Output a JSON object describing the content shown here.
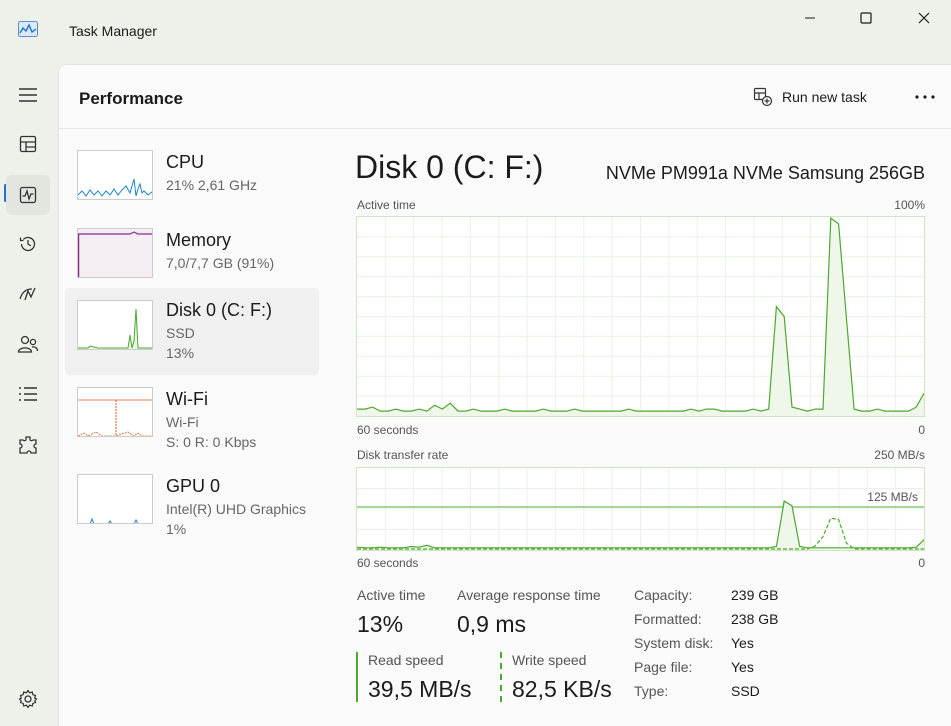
{
  "window": {
    "title": "Task Manager"
  },
  "nav": {
    "items": [
      {
        "name": "hamburger-menu",
        "icon": "hamburger-icon"
      },
      {
        "name": "processes",
        "icon": "processes-icon"
      },
      {
        "name": "performance",
        "icon": "performance-icon",
        "active": true
      },
      {
        "name": "app-history",
        "icon": "history-icon"
      },
      {
        "name": "startup-apps",
        "icon": "startup-icon"
      },
      {
        "name": "users",
        "icon": "users-icon"
      },
      {
        "name": "details",
        "icon": "details-icon"
      },
      {
        "name": "services",
        "icon": "services-icon"
      },
      {
        "name": "settings",
        "icon": "gear-icon"
      }
    ]
  },
  "header": {
    "title": "Performance",
    "run_new_task": "Run new task"
  },
  "devices": [
    {
      "name": "CPU",
      "line1": "21% 2,61 GHz",
      "line2": ""
    },
    {
      "name": "Memory",
      "line1": "7,0/7,7 GB (91%)",
      "line2": ""
    },
    {
      "name": "Disk 0 (C: F:)",
      "line1": "SSD",
      "line2": "13%",
      "selected": true
    },
    {
      "name": "Wi-Fi",
      "line1": "Wi-Fi",
      "line2": "S: 0 R: 0 Kbps"
    },
    {
      "name": "GPU 0",
      "line1": "Intel(R) UHD Graphics",
      "line2": "1%"
    }
  ],
  "detail": {
    "title": "Disk 0 (C: F:)",
    "model": "NVMe PM991a NVMe Samsung 256GB",
    "active_time_graph": {
      "label": "Active time",
      "max_label": "100%",
      "time_label": "60 seconds",
      "min_label": "0",
      "values": [
        3,
        3,
        4,
        2,
        2,
        3,
        2,
        2,
        3,
        2,
        5,
        3,
        6,
        2,
        2,
        3,
        2,
        2,
        2,
        3,
        2,
        2,
        2,
        2,
        3,
        2,
        2,
        2,
        3,
        2,
        2,
        2,
        2,
        2,
        2,
        3,
        2,
        2,
        2,
        2,
        2,
        2,
        2,
        3,
        2,
        3,
        3,
        2,
        2,
        2,
        2,
        3,
        2,
        3,
        55,
        50,
        4,
        3,
        2,
        3,
        3,
        100,
        97,
        50,
        3,
        2,
        2,
        3,
        2,
        2,
        2,
        2,
        4,
        11
      ]
    },
    "transfer_graph": {
      "label": "Disk transfer rate",
      "max_label": "250 MB/s",
      "mid_label": "125 MB/s",
      "time_label": "60 seconds",
      "min_label": "0",
      "read_values": [
        3,
        2,
        2,
        3,
        2,
        2,
        2,
        4,
        3,
        6,
        2,
        2,
        2,
        2,
        2,
        2,
        2,
        2,
        2,
        2,
        2,
        2,
        2,
        2,
        2,
        2,
        2,
        2,
        2,
        2,
        2,
        2,
        2,
        2,
        2,
        2,
        2,
        2,
        2,
        2,
        2,
        2,
        2,
        2,
        2,
        2,
        2,
        2,
        2,
        2,
        2,
        2,
        2,
        2,
        4,
        78,
        70,
        4,
        2,
        2,
        2,
        2,
        2,
        2,
        2,
        2,
        2,
        2,
        2,
        2,
        2,
        2,
        3,
        15
      ],
      "write_values": [
        0,
        0,
        0,
        0,
        0,
        0,
        0,
        0,
        0,
        0,
        0,
        0,
        0,
        0,
        0,
        0,
        0,
        0,
        0,
        0,
        0,
        0,
        0,
        0,
        0,
        0,
        0,
        0,
        0,
        0,
        0,
        0,
        0,
        0,
        0,
        0,
        0,
        0,
        0,
        0,
        0,
        0,
        0,
        0,
        0,
        0,
        0,
        0,
        0,
        0,
        0,
        0,
        0,
        0,
        0,
        0,
        0,
        0,
        0,
        5,
        20,
        50,
        48,
        10,
        0,
        0,
        0,
        0,
        0,
        0,
        0,
        0,
        0,
        0
      ]
    },
    "stats": {
      "active_time_label": "Active time",
      "active_time_value": "13%",
      "avg_response_label": "Average response time",
      "avg_response_value": "0,9 ms",
      "read_speed_label": "Read speed",
      "read_speed_value": "39,5 MB/s",
      "write_speed_label": "Write speed",
      "write_speed_value": "82,5 KB/s"
    },
    "properties": [
      {
        "label": "Capacity:",
        "value": "239 GB"
      },
      {
        "label": "Formatted:",
        "value": "238 GB"
      },
      {
        "label": "System disk:",
        "value": "Yes"
      },
      {
        "label": "Page file:",
        "value": "Yes"
      },
      {
        "label": "Type:",
        "value": "SSD"
      }
    ]
  },
  "colors": {
    "disk_green": "#4ea72e",
    "disk_fill": "#eef7ea",
    "memory_purple": "#8b2a8b",
    "cpu_blue": "#1a86c7",
    "wifi_orange": "#d65a1e",
    "accent_blue": "#1a73d9"
  }
}
